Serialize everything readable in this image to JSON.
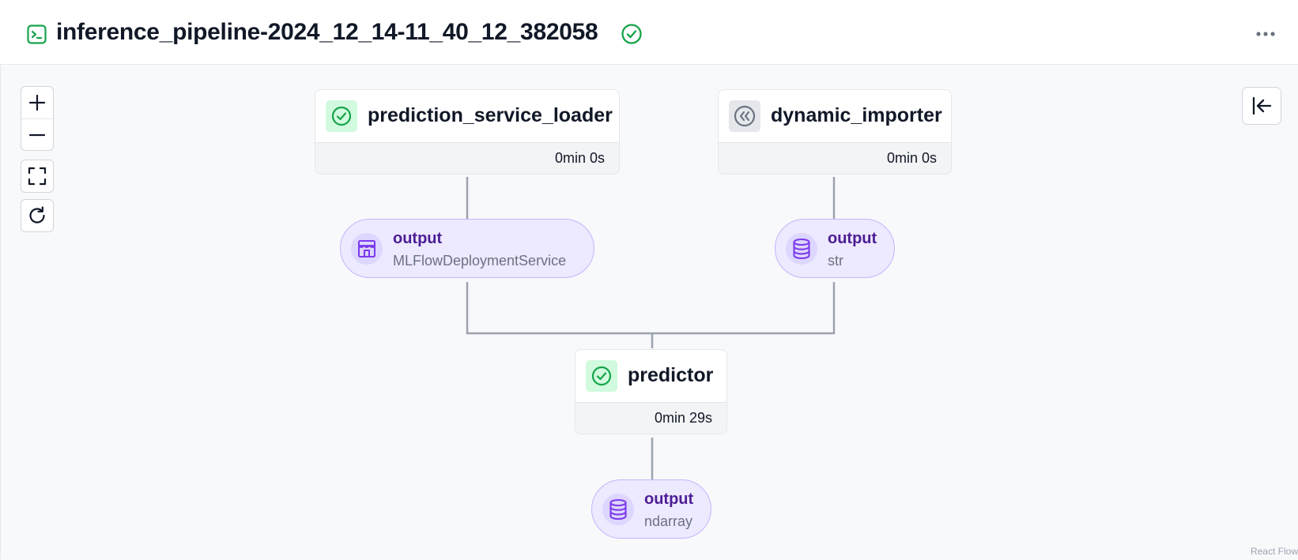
{
  "header": {
    "title": "inference_pipeline-2024_12_14-11_40_12_382058",
    "status_icon": "check-circle-icon",
    "more_icon": "ellipsis-icon"
  },
  "controls": {
    "zoom_in_icon": "plus-icon",
    "zoom_out_icon": "minus-icon",
    "fit_view_icon": "fit-view-icon",
    "refresh_icon": "refresh-icon",
    "collapse_icon": "collapse-panel-icon"
  },
  "steps": {
    "prediction_service_loader": {
      "name": "prediction_service_loader",
      "duration": "0min 0s",
      "status": "completed"
    },
    "dynamic_importer": {
      "name": "dynamic_importer",
      "duration": "0min 0s",
      "status": "cached"
    },
    "predictor": {
      "name": "predictor",
      "duration": "0min 29s",
      "status": "completed"
    }
  },
  "artifacts": {
    "loader_output": {
      "name": "output",
      "type": "MLFlowDeploymentService",
      "icon": "service-icon"
    },
    "importer_output": {
      "name": "output",
      "type": "str",
      "icon": "database-icon"
    },
    "predictor_output": {
      "name": "output",
      "type": "ndarray",
      "icon": "database-icon"
    }
  },
  "attribution": "React Flow",
  "colors": {
    "success": "#16a34a",
    "artifact_bg": "#ede9fe",
    "artifact_text": "#4c1d95",
    "edge": "#9ca3af"
  }
}
